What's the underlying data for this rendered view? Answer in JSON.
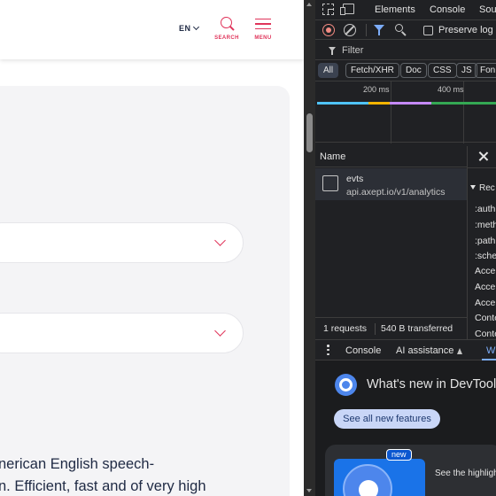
{
  "site": {
    "lang_label": "EN",
    "search_label": "SEARCH",
    "menu_label": "MENU",
    "body_text_line1": "nerican English speech-",
    "body_text_line2": "n.  Efficient, fast and of very high"
  },
  "devtools": {
    "tabs": [
      "Elements",
      "Console",
      "Sou"
    ],
    "toolbar": {
      "preserve_log_label": "Preserve log"
    },
    "filter": {
      "placeholder": "Filter"
    },
    "type_chips": [
      "All",
      "Fetch/XHR",
      "Doc",
      "CSS",
      "JS",
      "Fon"
    ],
    "active_type": "All",
    "timeline": {
      "ticks": [
        "200 ms",
        "400 ms"
      ]
    },
    "table": {
      "name_header": "Name",
      "rows": [
        {
          "name": "evts",
          "url": "api.axept.io/v1/analytics"
        }
      ]
    },
    "details": {
      "section": "Rec",
      "items": [
        ":auth",
        ":meth",
        ":path",
        ":sche",
        "Accep",
        "Accep",
        "Accep",
        "Conte",
        "Conte"
      ]
    },
    "status": {
      "requests": "1 requests",
      "transferred": "540 B transferred"
    },
    "drawer_tabs": [
      "Console",
      "AI assistance",
      "W"
    ],
    "whats_new": {
      "title": "What's new in DevTool",
      "button": "See all new features",
      "badge": "new",
      "card_text": "See the highligh"
    }
  },
  "colors": {
    "brand_accent": "#e0355b",
    "devtools_bg": "#202124",
    "devtools_accent": "#7cacf8"
  }
}
